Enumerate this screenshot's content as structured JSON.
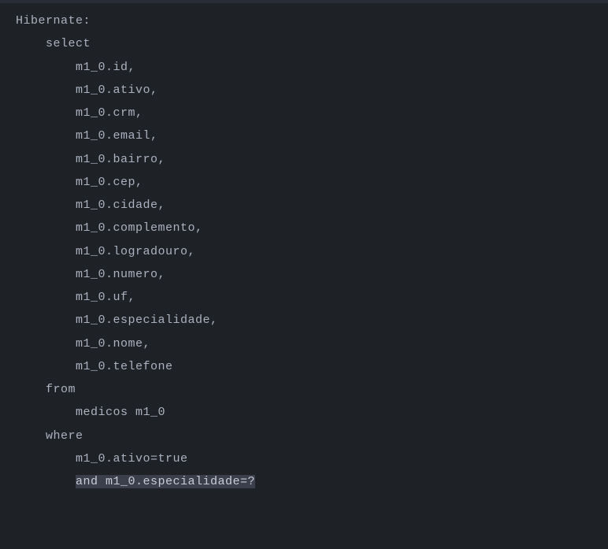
{
  "code": {
    "line1": "Hibernate:",
    "line2": "    select",
    "line3": "        m1_0.id,",
    "line4": "        m1_0.ativo,",
    "line5": "        m1_0.crm,",
    "line6": "        m1_0.email,",
    "line7": "        m1_0.bairro,",
    "line8": "        m1_0.cep,",
    "line9": "        m1_0.cidade,",
    "line10": "        m1_0.complemento,",
    "line11": "        m1_0.logradouro,",
    "line12": "        m1_0.numero,",
    "line13": "        m1_0.uf,",
    "line14": "        m1_0.especialidade,",
    "line15": "        m1_0.nome,",
    "line16": "        m1_0.telefone",
    "line17": "    from",
    "line18": "        medicos m1_0",
    "line19": "    where",
    "line20": "        m1_0.ativo=true",
    "line21_prefix": "        ",
    "line21_hl": "and m1_0.especialidade=?"
  }
}
